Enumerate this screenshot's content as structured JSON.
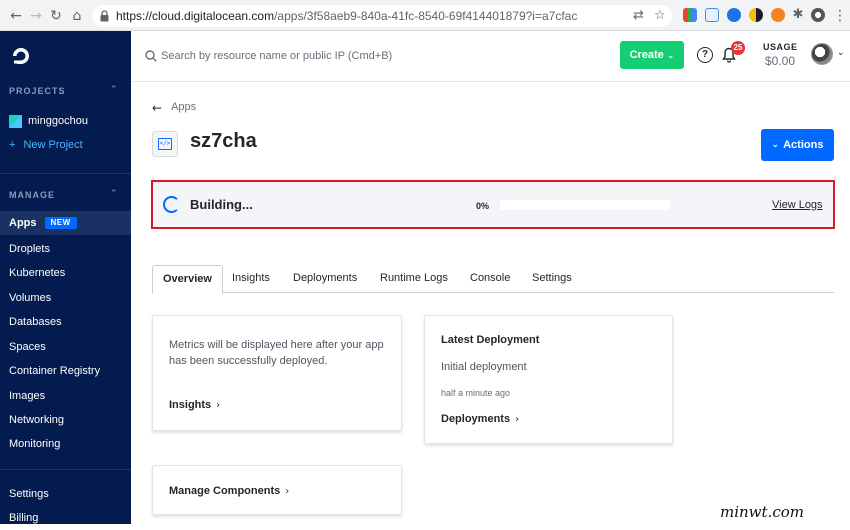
{
  "browser": {
    "url_host": "https://cloud.digitalocean.com",
    "url_path": "/apps/3f58aeb9-840a-41fc-8540-69f414401879?i=a7cfac"
  },
  "sidebar": {
    "projects_heading": "PROJECTS",
    "project_name": "minggochou",
    "new_project": "New Project",
    "manage_heading": "MANAGE",
    "items": [
      {
        "label": "Apps",
        "badge": "NEW"
      },
      {
        "label": "Droplets"
      },
      {
        "label": "Kubernetes"
      },
      {
        "label": "Volumes"
      },
      {
        "label": "Databases"
      },
      {
        "label": "Spaces"
      },
      {
        "label": "Container Registry"
      },
      {
        "label": "Images"
      },
      {
        "label": "Networking"
      },
      {
        "label": "Monitoring"
      }
    ],
    "bottom_items": [
      {
        "label": "Settings"
      },
      {
        "label": "Billing"
      }
    ]
  },
  "topbar": {
    "search_placeholder": "Search by resource name or public IP (Cmd+B)",
    "create_label": "Create",
    "notification_count": "25",
    "usage_label": "USAGE",
    "usage_value": "$0.00"
  },
  "app": {
    "back_label": "Apps",
    "name": "sz7cha",
    "actions_label": "Actions"
  },
  "build": {
    "status": "Building...",
    "progress_text": "0%",
    "progress": 0,
    "view_logs": "View Logs"
  },
  "tabs": [
    "Overview",
    "Insights",
    "Deployments",
    "Runtime Logs",
    "Console",
    "Settings"
  ],
  "cards": {
    "metrics_text_1": "Metrics will be displayed here after your app",
    "metrics_text_2": "has been successfully deployed.",
    "insights_link": "Insights",
    "latest_title": "Latest Deployment",
    "latest_desc": "Initial deployment",
    "latest_time": "half a minute ago",
    "deployments_link": "Deployments",
    "manage_components": "Manage Components"
  },
  "watermark": "minwt.com",
  "colors": {
    "sidebar_bg": "#031b4e",
    "accent_blue": "#0069ff",
    "create_green": "#15cd72",
    "highlight_red": "#d9192a"
  }
}
